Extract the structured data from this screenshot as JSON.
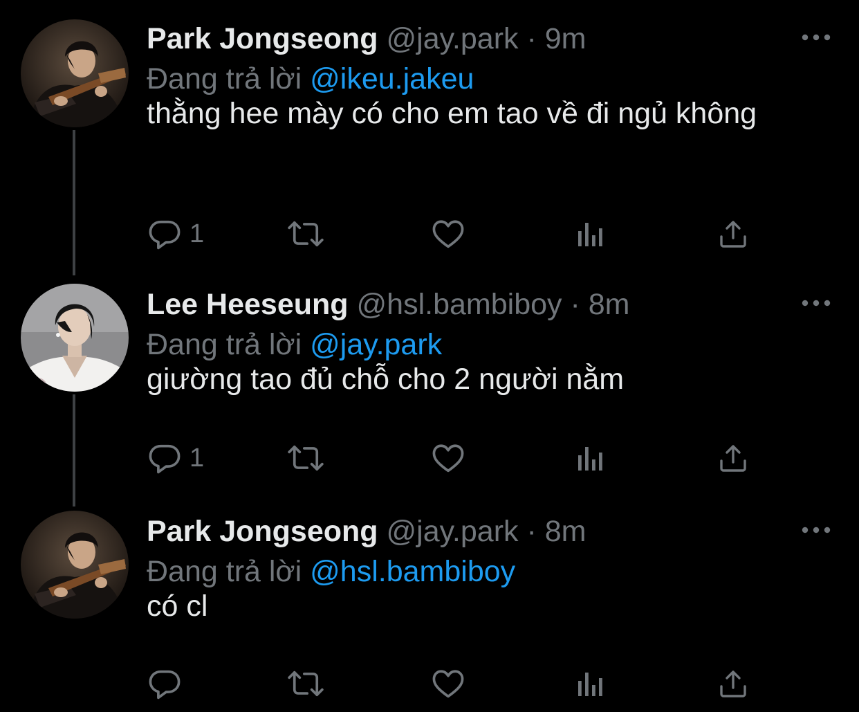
{
  "thread": {
    "tweets": [
      {
        "name": "Park Jongseong",
        "handle": "@jay.park",
        "separator": "·",
        "time": "9m",
        "replying_label": "Đang trả lời",
        "replying_to": "@ikeu.jakeu",
        "text": "thằng hee mày có cho em tao về đi ngủ không",
        "reply_count": "1",
        "retweet_count": "",
        "like_count": ""
      },
      {
        "name": "Lee Heeseung",
        "handle": "@hsl.bambiboy",
        "separator": "·",
        "time": "8m",
        "replying_label": "Đang trả lời",
        "replying_to": "@jay.park",
        "text": "giường tao đủ chỗ cho 2 người nằm",
        "reply_count": "1",
        "retweet_count": "",
        "like_count": ""
      },
      {
        "name": "Park Jongseong",
        "handle": "@jay.park",
        "separator": "·",
        "time": "8m",
        "replying_label": "Đang trả lời",
        "replying_to": "@hsl.bambiboy",
        "text": "có cl",
        "reply_count": "",
        "retweet_count": "",
        "like_count": ""
      }
    ]
  },
  "colors": {
    "background": "#000000",
    "primary_text": "#e7e9ea",
    "secondary_text": "#71767b",
    "mention": "#1d9bf0",
    "thread_line": "#3e4144"
  },
  "icons": {
    "reply": "reply-icon",
    "retweet": "retweet-icon",
    "like": "heart-icon",
    "views": "views-icon",
    "share": "share-icon",
    "more": "more-icon"
  }
}
